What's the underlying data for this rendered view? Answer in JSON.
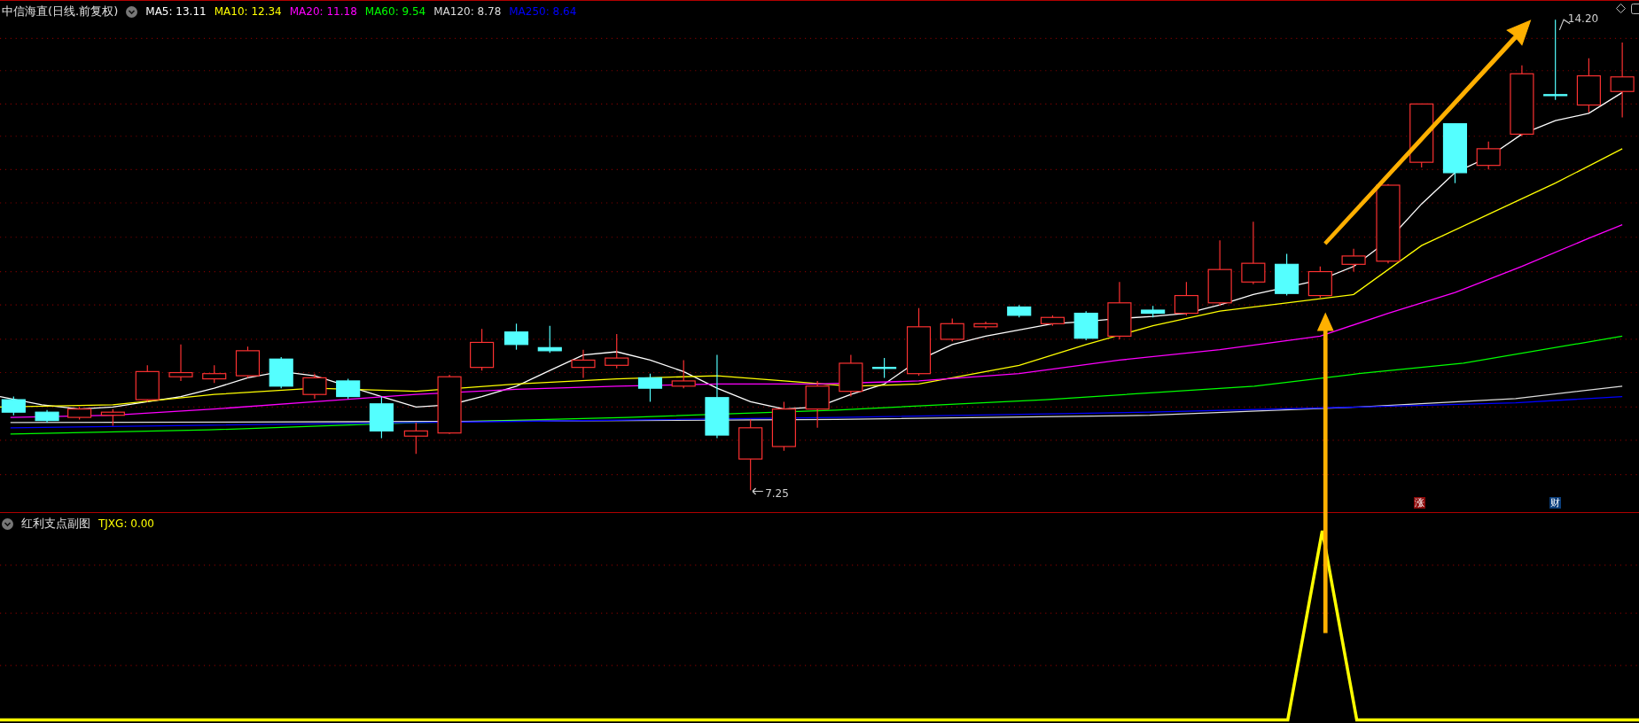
{
  "main_chart": {
    "title": "中信海直(日线.前复权)",
    "indicators": [
      {
        "label": "MA5: 13.11",
        "color": "#ffffff"
      },
      {
        "label": "MA10: 12.34",
        "color": "#ffff00"
      },
      {
        "label": "MA20: 11.18",
        "color": "#ff00ff"
      },
      {
        "label": "MA60: 9.54",
        "color": "#00ff00"
      },
      {
        "label": "MA120: 8.78",
        "color": "#dcdcdc"
      },
      {
        "label": "MA250: 8.64",
        "color": "#0000ff"
      }
    ],
    "price_labels": [
      {
        "text": "14.20"
      },
      {
        "text": "7.25"
      }
    ],
    "badges": [
      {
        "text": "涨",
        "color": "#8b0a0a"
      },
      {
        "text": "财",
        "color": "#0a3d7a"
      }
    ]
  },
  "sub_chart": {
    "title": "红利支点副图",
    "indicators": [
      {
        "label": "TJXG: 0.00",
        "color": "#ffff00"
      }
    ]
  }
}
